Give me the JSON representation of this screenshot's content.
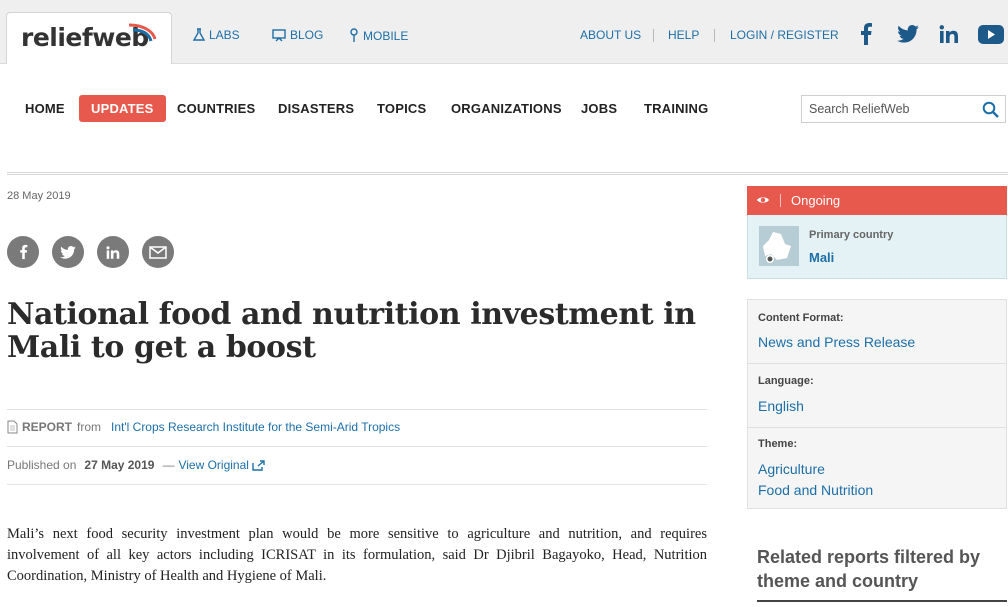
{
  "topbar": {
    "logo": "reliefweb",
    "links": [
      {
        "label": "LABS",
        "icon": "flask-icon"
      },
      {
        "label": "BLOG",
        "icon": "blog-icon"
      },
      {
        "label": "MOBILE",
        "icon": "mobile-icon"
      }
    ],
    "right_links": [
      "ABOUT US",
      "HELP",
      "LOGIN / REGISTER"
    ],
    "social": [
      "facebook-icon",
      "twitter-icon",
      "linkedin-icon",
      "youtube-icon"
    ]
  },
  "nav": {
    "items": [
      "HOME",
      "UPDATES",
      "COUNTRIES",
      "DISASTERS",
      "TOPICS",
      "ORGANIZATIONS",
      "JOBS",
      "TRAINING"
    ],
    "active": "UPDATES",
    "search_placeholder": "Search ReliefWeb"
  },
  "article": {
    "date": "28 May 2019",
    "title": "National food and nutrition investment in Mali to get a boost",
    "report_kind": "REPORT",
    "from_label": "from",
    "source": "Int'l Crops Research Institute for the Semi-Arid Tropics",
    "published_label": "Published on",
    "published_date": "27 May 2019",
    "dash": "—",
    "view_original": "View Original",
    "body": "Mali’s next food security investment plan would be more sensitive to agriculture and nutrition, and requires involvement of all key actors including ICRISAT in its formulation, said Dr Djibril Bagayoko, Head, Nutrition Coordination, Ministry of Health and Hygiene of Mali."
  },
  "sidebar": {
    "status": "Ongoing",
    "primary_country_label": "Primary country",
    "primary_country": "Mali",
    "content_format_label": "Content Format:",
    "content_format": "News and Press Release",
    "language_label": "Language:",
    "language": "English",
    "theme_label": "Theme:",
    "themes": [
      "Agriculture",
      "Food and Nutrition"
    ],
    "related_title": "Related reports filtered by theme and country"
  },
  "colors": {
    "accent": "#e8594d",
    "link": "#1d6fa8",
    "social": "#1d5a8a"
  }
}
